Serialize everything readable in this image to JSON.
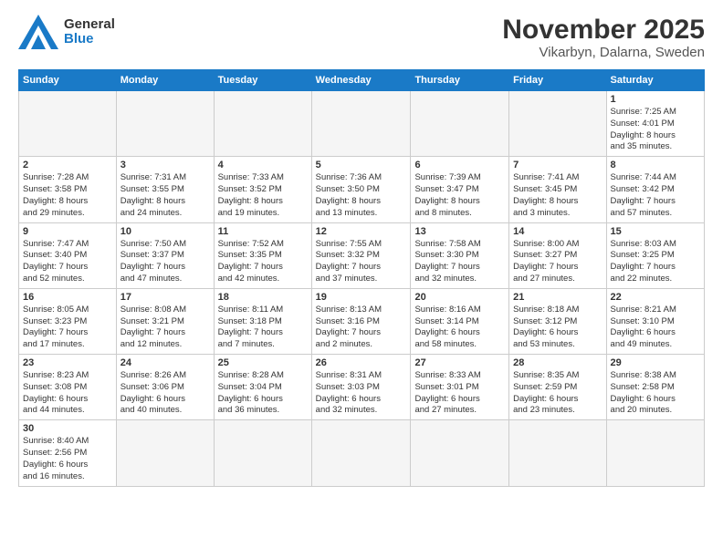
{
  "header": {
    "logo_general": "General",
    "logo_blue": "Blue",
    "month_title": "November 2025",
    "subtitle": "Vikarbyn, Dalarna, Sweden"
  },
  "weekdays": [
    "Sunday",
    "Monday",
    "Tuesday",
    "Wednesday",
    "Thursday",
    "Friday",
    "Saturday"
  ],
  "weeks": [
    [
      {
        "day": "",
        "empty": true
      },
      {
        "day": "",
        "empty": true
      },
      {
        "day": "",
        "empty": true
      },
      {
        "day": "",
        "empty": true
      },
      {
        "day": "",
        "empty": true
      },
      {
        "day": "",
        "empty": true
      },
      {
        "day": "1",
        "info": "Sunrise: 7:25 AM\nSunset: 4:01 PM\nDaylight: 8 hours\nand 35 minutes."
      }
    ],
    [
      {
        "day": "2",
        "info": "Sunrise: 7:28 AM\nSunset: 3:58 PM\nDaylight: 8 hours\nand 29 minutes."
      },
      {
        "day": "3",
        "info": "Sunrise: 7:31 AM\nSunset: 3:55 PM\nDaylight: 8 hours\nand 24 minutes."
      },
      {
        "day": "4",
        "info": "Sunrise: 7:33 AM\nSunset: 3:52 PM\nDaylight: 8 hours\nand 19 minutes."
      },
      {
        "day": "5",
        "info": "Sunrise: 7:36 AM\nSunset: 3:50 PM\nDaylight: 8 hours\nand 13 minutes."
      },
      {
        "day": "6",
        "info": "Sunrise: 7:39 AM\nSunset: 3:47 PM\nDaylight: 8 hours\nand 8 minutes."
      },
      {
        "day": "7",
        "info": "Sunrise: 7:41 AM\nSunset: 3:45 PM\nDaylight: 8 hours\nand 3 minutes."
      },
      {
        "day": "8",
        "info": "Sunrise: 7:44 AM\nSunset: 3:42 PM\nDaylight: 7 hours\nand 57 minutes."
      }
    ],
    [
      {
        "day": "9",
        "info": "Sunrise: 7:47 AM\nSunset: 3:40 PM\nDaylight: 7 hours\nand 52 minutes."
      },
      {
        "day": "10",
        "info": "Sunrise: 7:50 AM\nSunset: 3:37 PM\nDaylight: 7 hours\nand 47 minutes."
      },
      {
        "day": "11",
        "info": "Sunrise: 7:52 AM\nSunset: 3:35 PM\nDaylight: 7 hours\nand 42 minutes."
      },
      {
        "day": "12",
        "info": "Sunrise: 7:55 AM\nSunset: 3:32 PM\nDaylight: 7 hours\nand 37 minutes."
      },
      {
        "day": "13",
        "info": "Sunrise: 7:58 AM\nSunset: 3:30 PM\nDaylight: 7 hours\nand 32 minutes."
      },
      {
        "day": "14",
        "info": "Sunrise: 8:00 AM\nSunset: 3:27 PM\nDaylight: 7 hours\nand 27 minutes."
      },
      {
        "day": "15",
        "info": "Sunrise: 8:03 AM\nSunset: 3:25 PM\nDaylight: 7 hours\nand 22 minutes."
      }
    ],
    [
      {
        "day": "16",
        "info": "Sunrise: 8:05 AM\nSunset: 3:23 PM\nDaylight: 7 hours\nand 17 minutes."
      },
      {
        "day": "17",
        "info": "Sunrise: 8:08 AM\nSunset: 3:21 PM\nDaylight: 7 hours\nand 12 minutes."
      },
      {
        "day": "18",
        "info": "Sunrise: 8:11 AM\nSunset: 3:18 PM\nDaylight: 7 hours\nand 7 minutes."
      },
      {
        "day": "19",
        "info": "Sunrise: 8:13 AM\nSunset: 3:16 PM\nDaylight: 7 hours\nand 2 minutes."
      },
      {
        "day": "20",
        "info": "Sunrise: 8:16 AM\nSunset: 3:14 PM\nDaylight: 6 hours\nand 58 minutes."
      },
      {
        "day": "21",
        "info": "Sunrise: 8:18 AM\nSunset: 3:12 PM\nDaylight: 6 hours\nand 53 minutes."
      },
      {
        "day": "22",
        "info": "Sunrise: 8:21 AM\nSunset: 3:10 PM\nDaylight: 6 hours\nand 49 minutes."
      }
    ],
    [
      {
        "day": "23",
        "info": "Sunrise: 8:23 AM\nSunset: 3:08 PM\nDaylight: 6 hours\nand 44 minutes."
      },
      {
        "day": "24",
        "info": "Sunrise: 8:26 AM\nSunset: 3:06 PM\nDaylight: 6 hours\nand 40 minutes."
      },
      {
        "day": "25",
        "info": "Sunrise: 8:28 AM\nSunset: 3:04 PM\nDaylight: 6 hours\nand 36 minutes."
      },
      {
        "day": "26",
        "info": "Sunrise: 8:31 AM\nSunset: 3:03 PM\nDaylight: 6 hours\nand 32 minutes."
      },
      {
        "day": "27",
        "info": "Sunrise: 8:33 AM\nSunset: 3:01 PM\nDaylight: 6 hours\nand 27 minutes."
      },
      {
        "day": "28",
        "info": "Sunrise: 8:35 AM\nSunset: 2:59 PM\nDaylight: 6 hours\nand 23 minutes."
      },
      {
        "day": "29",
        "info": "Sunrise: 8:38 AM\nSunset: 2:58 PM\nDaylight: 6 hours\nand 20 minutes."
      }
    ],
    [
      {
        "day": "30",
        "info": "Sunrise: 8:40 AM\nSunset: 2:56 PM\nDaylight: 6 hours\nand 16 minutes."
      },
      {
        "day": "",
        "empty": true
      },
      {
        "day": "",
        "empty": true
      },
      {
        "day": "",
        "empty": true
      },
      {
        "day": "",
        "empty": true
      },
      {
        "day": "",
        "empty": true
      },
      {
        "day": "",
        "empty": true
      }
    ]
  ]
}
